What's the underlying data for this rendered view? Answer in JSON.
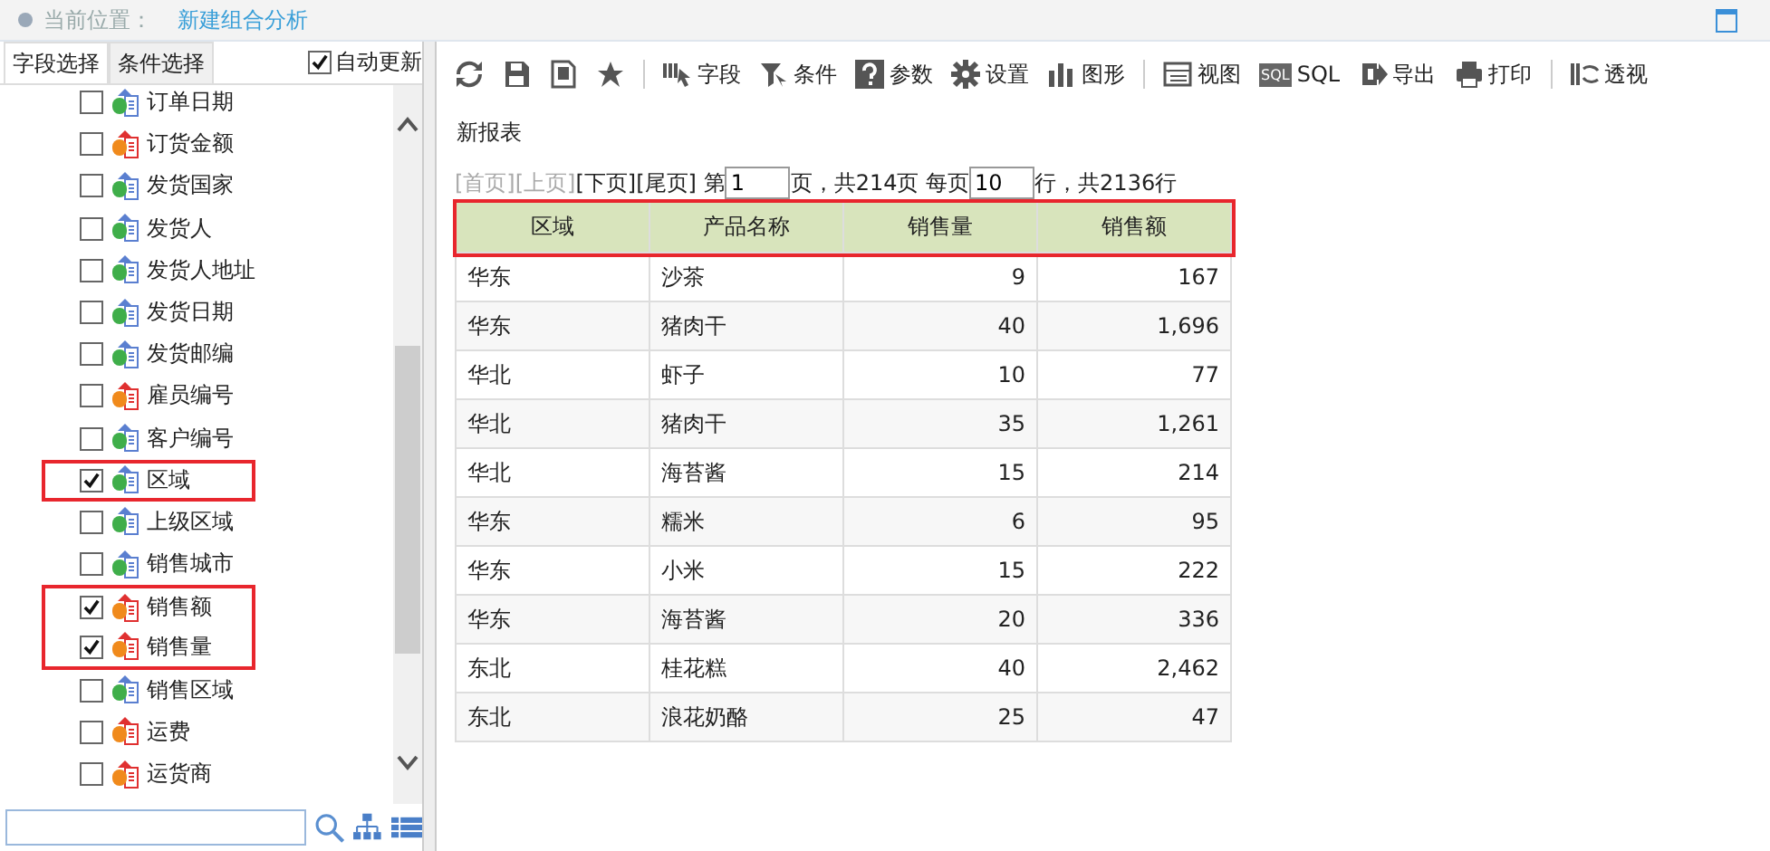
{
  "breadcrumb": {
    "label": "当前位置：",
    "current": "新建组合分析"
  },
  "left_tabs": [
    {
      "label": "字段选择",
      "selected": true
    },
    {
      "label": "条件选择",
      "selected": false
    }
  ],
  "auto_update": {
    "label": "自动更新",
    "checked": true
  },
  "fields": [
    {
      "label": "订单日期",
      "kind": "dimension",
      "checked": false,
      "highlighted": false
    },
    {
      "label": "订货金额",
      "kind": "measure",
      "checked": false,
      "highlighted": false
    },
    {
      "label": "发货国家",
      "kind": "dimension",
      "checked": false,
      "highlighted": false
    },
    {
      "label": "发货人",
      "kind": "dimension",
      "checked": false,
      "highlighted": false
    },
    {
      "label": "发货人地址",
      "kind": "dimension",
      "checked": false,
      "highlighted": false
    },
    {
      "label": "发货日期",
      "kind": "dimension",
      "checked": false,
      "highlighted": false
    },
    {
      "label": "发货邮编",
      "kind": "dimension",
      "checked": false,
      "highlighted": false
    },
    {
      "label": "雇员编号",
      "kind": "measure",
      "checked": false,
      "highlighted": false
    },
    {
      "label": "客户编号",
      "kind": "dimension",
      "checked": false,
      "highlighted": false
    },
    {
      "label": "区域",
      "kind": "dimension",
      "checked": true,
      "highlighted": true
    },
    {
      "label": "上级区域",
      "kind": "dimension",
      "checked": false,
      "highlighted": false
    },
    {
      "label": "销售城市",
      "kind": "dimension",
      "checked": false,
      "highlighted": false
    },
    {
      "label": "销售额",
      "kind": "measure",
      "checked": true,
      "highlighted": true
    },
    {
      "label": "销售量",
      "kind": "measure",
      "checked": true,
      "highlighted": true
    },
    {
      "label": "销售区域",
      "kind": "dimension",
      "checked": false,
      "highlighted": false
    },
    {
      "label": "运费",
      "kind": "measure",
      "checked": false,
      "highlighted": false
    },
    {
      "label": "运货商",
      "kind": "measure",
      "checked": false,
      "highlighted": false
    }
  ],
  "toolbar": [
    {
      "kind": "refresh"
    },
    {
      "kind": "save"
    },
    {
      "kind": "save-as"
    },
    {
      "kind": "star"
    },
    {
      "kind": "sep"
    },
    {
      "kind": "field",
      "label": "字段"
    },
    {
      "kind": "filter",
      "label": "条件"
    },
    {
      "kind": "help",
      "label": "参数"
    },
    {
      "kind": "gear",
      "label": "设置"
    },
    {
      "kind": "bars",
      "label": "图形"
    },
    {
      "kind": "sep"
    },
    {
      "kind": "view",
      "label": "视图"
    },
    {
      "kind": "sql",
      "icon_text": "SQL",
      "label": "SQL"
    },
    {
      "kind": "export",
      "label": "导出"
    },
    {
      "kind": "print",
      "label": "打印"
    },
    {
      "kind": "sep"
    },
    {
      "kind": "pivot",
      "label": "透视"
    }
  ],
  "report_title": "新报表",
  "pager": {
    "links": [
      {
        "label": "[首页]",
        "disabled": true
      },
      {
        "label": "[上页]",
        "disabled": true
      },
      {
        "label": "[下页]",
        "disabled": false
      },
      {
        "label": "[尾页]",
        "disabled": false
      }
    ],
    "page_prefix": "第",
    "page": "1",
    "page_suffix": "页，共214页 每页",
    "per_page": "10",
    "total": "行，共2136行"
  },
  "table": {
    "header_highlighted": true,
    "columns": [
      "区域",
      "产品名称",
      "销售量",
      "销售额"
    ],
    "rows": [
      [
        "华东",
        "沙茶",
        "9",
        "167"
      ],
      [
        "华东",
        "猪肉干",
        "40",
        "1,696"
      ],
      [
        "华北",
        "虾子",
        "10",
        "77"
      ],
      [
        "华北",
        "猪肉干",
        "35",
        "1,261"
      ],
      [
        "华北",
        "海苔酱",
        "15",
        "214"
      ],
      [
        "华东",
        "糯米",
        "6",
        "95"
      ],
      [
        "华东",
        "小米",
        "15",
        "222"
      ],
      [
        "华东",
        "海苔酱",
        "20",
        "336"
      ],
      [
        "东北",
        "桂花糕",
        "40",
        "2,462"
      ],
      [
        "东北",
        "浪花奶酪",
        "25",
        "47"
      ]
    ]
  }
}
